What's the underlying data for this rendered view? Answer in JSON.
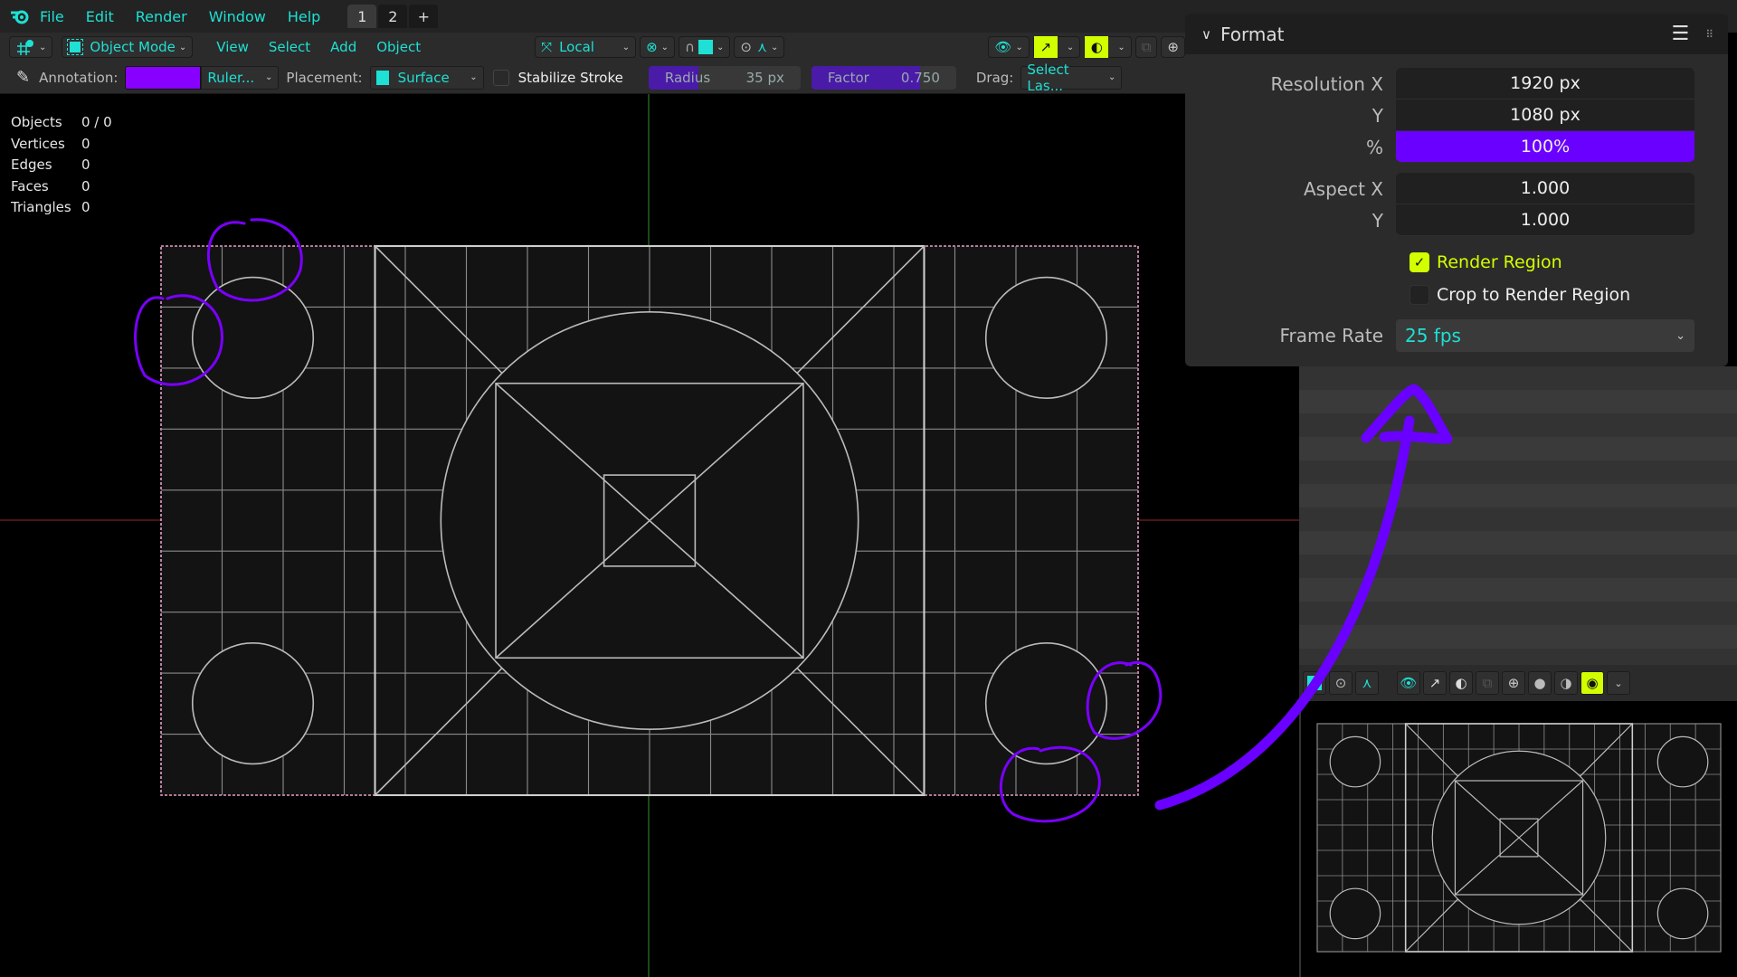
{
  "menubar": {
    "menus": [
      "File",
      "Edit",
      "Render",
      "Window",
      "Help"
    ],
    "workspace_tabs": [
      "1",
      "2"
    ],
    "add_workspace": "+"
  },
  "header": {
    "editor_type_icon": "viewport-gizmo-icon",
    "mode": "Object Mode",
    "menus": [
      "View",
      "Select",
      "Add",
      "Object"
    ],
    "transform_orientation": "Local",
    "pivot_icon": "pivot-point-icon",
    "snap_icon": "magnet-icon",
    "proportional_icon": "proportional-edit-icon",
    "right_icons": [
      "visibility-icon",
      "gizmo-icon",
      "overlay-icon",
      "xray-icon",
      "wireframe-shading-icon"
    ]
  },
  "tool_settings": {
    "annotation_label": "Annotation:",
    "annotation_color": "#8800ff",
    "annotation_layer": "Ruler...",
    "placement_label": "Placement:",
    "placement_value": "Surface",
    "stabilize_label": "Stabilize Stroke",
    "stabilize_checked": false,
    "radius_label": "Radius",
    "radius_value": "35 px",
    "radius_fill": 0.33,
    "factor_label": "Factor",
    "factor_value": "0.750",
    "factor_fill": 0.75,
    "drag_label": "Drag:",
    "drag_value": "Select Las..."
  },
  "stats": [
    {
      "label": "Objects",
      "value": "0 / 0"
    },
    {
      "label": "Vertices",
      "value": "0"
    },
    {
      "label": "Edges",
      "value": "0"
    },
    {
      "label": "Faces",
      "value": "0"
    },
    {
      "label": "Triangles",
      "value": "0"
    }
  ],
  "format_panel": {
    "title": "Format",
    "resolution_x_label": "Resolution X",
    "resolution_x": "1920 px",
    "resolution_y_label": "Y",
    "resolution_y": "1080 px",
    "percent_label": "%",
    "percent": "100%",
    "aspect_x_label": "Aspect X",
    "aspect_x": "1.000",
    "aspect_y_label": "Y",
    "aspect_y": "1.000",
    "render_region_label": "Render Region",
    "render_region_checked": true,
    "crop_label": "Crop to Render Region",
    "crop_checked": false,
    "frame_rate_label": "Frame Rate",
    "frame_rate": "25 fps"
  },
  "colors": {
    "accent_teal": "#1ee0d4",
    "accent_lime": "#d2ff00",
    "annotation_purple": "#7a00ff",
    "slider_fill": "#4a1aa8"
  }
}
